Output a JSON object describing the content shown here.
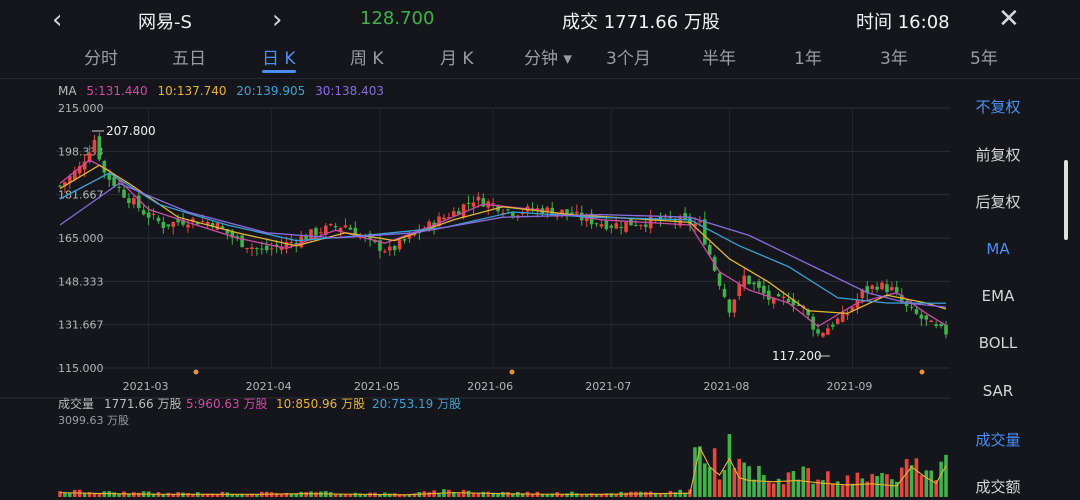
{
  "header": {
    "back_icon": "chevron-left-icon",
    "title": "网易-S",
    "forward_icon": "chevron-right-icon",
    "price": "128.700",
    "volume": "成交 1771.66 万股",
    "time": "时间 16:08",
    "close_icon": "close-icon"
  },
  "tabs": [
    {
      "label": "分时"
    },
    {
      "label": "五日"
    },
    {
      "label": "日 K"
    },
    {
      "label": "周 K"
    },
    {
      "label": "月 K"
    },
    {
      "label": "分钟 ▾"
    },
    {
      "label": "3个月"
    },
    {
      "label": "半年"
    },
    {
      "label": "1年"
    },
    {
      "label": "3年"
    },
    {
      "label": "5年"
    }
  ],
  "active_tab": "日 K",
  "ma_legend": {
    "label": "MA",
    "ma5": "5:131.440",
    "ma10": "10:137.740",
    "ma20": "20:139.905",
    "ma30": "30:138.403"
  },
  "volume_legend": {
    "label": "成交量",
    "value": "1771.66 万股",
    "ma5": "5:960.63 万股",
    "ma10": "10:850.96 万股",
    "ma20": "20:753.19 万股",
    "max": "3099.63 万股"
  },
  "sidebar": [
    {
      "label": "不复权",
      "active": true
    },
    {
      "label": "前复权",
      "active": false
    },
    {
      "label": "后复权",
      "active": false
    },
    {
      "label": "MA",
      "active": true
    },
    {
      "label": "EMA",
      "active": false
    },
    {
      "label": "BOLL",
      "active": false
    },
    {
      "label": "SAR",
      "active": false
    },
    {
      "label": "成交量",
      "active": true
    },
    {
      "label": "成交额",
      "active": false
    }
  ],
  "colors": {
    "up": "#e8453c",
    "down": "#3fb24a",
    "price": "#3fb24a",
    "accent": "#4b8ef5",
    "ma5": "#d04aa7",
    "ma10": "#e8b432",
    "ma20": "#3aa2d8",
    "ma30": "#8a6be0"
  },
  "chart_data": {
    "type": "candlestick",
    "ytick_labels": [
      "215.000",
      "198.333",
      "181.667",
      "165.000",
      "148.333",
      "131.667",
      "115.000"
    ],
    "ylim": [
      115,
      215
    ],
    "xtick_labels": [
      "2021-03",
      "2021-04",
      "2021-05",
      "2021-06",
      "2021-07",
      "2021-08",
      "2021-09"
    ],
    "annotations": {
      "high": "207.800",
      "low": "117.200"
    },
    "close_path": [
      [
        0,
        185
      ],
      [
        4,
        192
      ],
      [
        7,
        203
      ],
      [
        9,
        190
      ],
      [
        13,
        182
      ],
      [
        17,
        175
      ],
      [
        21,
        170
      ],
      [
        26,
        172
      ],
      [
        31,
        171
      ],
      [
        36,
        164
      ],
      [
        41,
        160
      ],
      [
        45,
        162
      ],
      [
        49,
        165
      ],
      [
        53,
        168
      ],
      [
        58,
        170
      ],
      [
        63,
        163
      ],
      [
        67,
        160
      ],
      [
        71,
        165
      ],
      [
        76,
        171
      ],
      [
        80,
        175
      ],
      [
        84,
        180
      ],
      [
        88,
        178
      ],
      [
        92,
        175
      ],
      [
        97,
        176
      ],
      [
        102,
        175
      ],
      [
        107,
        172
      ],
      [
        112,
        170
      ],
      [
        118,
        171
      ],
      [
        124,
        172
      ],
      [
        130,
        170
      ],
      [
        133,
        153
      ],
      [
        136,
        138
      ],
      [
        139,
        150
      ],
      [
        142,
        145
      ],
      [
        145,
        140
      ],
      [
        148,
        142
      ],
      [
        151,
        138
      ],
      [
        154,
        128
      ],
      [
        157,
        132
      ],
      [
        160,
        136
      ],
      [
        163,
        144
      ],
      [
        166,
        147
      ],
      [
        169,
        145
      ],
      [
        172,
        138
      ],
      [
        175,
        134
      ],
      [
        178,
        130
      ],
      [
        180,
        128.7
      ]
    ],
    "ma_paths": {
      "ma5": [
        [
          0,
          186
        ],
        [
          6,
          195
        ],
        [
          10,
          191
        ],
        [
          18,
          176
        ],
        [
          26,
          171
        ],
        [
          36,
          165
        ],
        [
          46,
          161
        ],
        [
          56,
          168
        ],
        [
          66,
          163
        ],
        [
          76,
          170
        ],
        [
          86,
          178
        ],
        [
          96,
          176
        ],
        [
          110,
          172
        ],
        [
          128,
          170
        ],
        [
          134,
          152
        ],
        [
          140,
          145
        ],
        [
          148,
          140
        ],
        [
          154,
          131
        ],
        [
          162,
          140
        ],
        [
          170,
          144
        ],
        [
          176,
          136
        ],
        [
          180,
          131.4
        ]
      ],
      "ma10": [
        [
          0,
          184
        ],
        [
          8,
          193
        ],
        [
          14,
          186
        ],
        [
          24,
          173
        ],
        [
          36,
          167
        ],
        [
          48,
          162
        ],
        [
          58,
          167
        ],
        [
          68,
          164
        ],
        [
          80,
          172
        ],
        [
          90,
          177
        ],
        [
          104,
          174
        ],
        [
          128,
          171
        ],
        [
          136,
          157
        ],
        [
          144,
          148
        ],
        [
          152,
          137
        ],
        [
          160,
          136
        ],
        [
          168,
          143
        ],
        [
          176,
          140
        ],
        [
          180,
          137.7
        ]
      ],
      "ma20": [
        [
          0,
          180
        ],
        [
          10,
          190
        ],
        [
          20,
          178
        ],
        [
          34,
          170
        ],
        [
          48,
          164
        ],
        [
          62,
          166
        ],
        [
          78,
          169
        ],
        [
          92,
          175
        ],
        [
          108,
          173
        ],
        [
          128,
          172
        ],
        [
          138,
          162
        ],
        [
          148,
          154
        ],
        [
          158,
          142
        ],
        [
          168,
          140
        ],
        [
          180,
          139.9
        ]
      ],
      "ma30": [
        [
          0,
          170
        ],
        [
          12,
          186
        ],
        [
          26,
          175
        ],
        [
          42,
          167
        ],
        [
          56,
          165
        ],
        [
          72,
          167
        ],
        [
          90,
          173
        ],
        [
          110,
          174
        ],
        [
          128,
          173
        ],
        [
          140,
          166
        ],
        [
          152,
          155
        ],
        [
          164,
          144
        ],
        [
          172,
          140
        ],
        [
          180,
          138.4
        ]
      ]
    },
    "volume_levels": [
      [
        0,
        0.08
      ],
      [
        10,
        0.06
      ],
      [
        20,
        0.05
      ],
      [
        30,
        0.05
      ],
      [
        40,
        0.05
      ],
      [
        50,
        0.06
      ],
      [
        60,
        0.05
      ],
      [
        70,
        0.04
      ],
      [
        80,
        0.08
      ],
      [
        90,
        0.06
      ],
      [
        100,
        0.05
      ],
      [
        110,
        0.05
      ],
      [
        120,
        0.06
      ],
      [
        128,
        0.07
      ],
      [
        130,
        0.9
      ],
      [
        132,
        0.55
      ],
      [
        134,
        0.4
      ],
      [
        136,
        0.7
      ],
      [
        138,
        0.35
      ],
      [
        140,
        0.3
      ],
      [
        145,
        0.28
      ],
      [
        150,
        0.3
      ],
      [
        155,
        0.25
      ],
      [
        160,
        0.22
      ],
      [
        165,
        0.24
      ],
      [
        170,
        0.2
      ],
      [
        173,
        0.55
      ],
      [
        176,
        0.35
      ],
      [
        178,
        0.25
      ],
      [
        180,
        0.57
      ]
    ]
  }
}
